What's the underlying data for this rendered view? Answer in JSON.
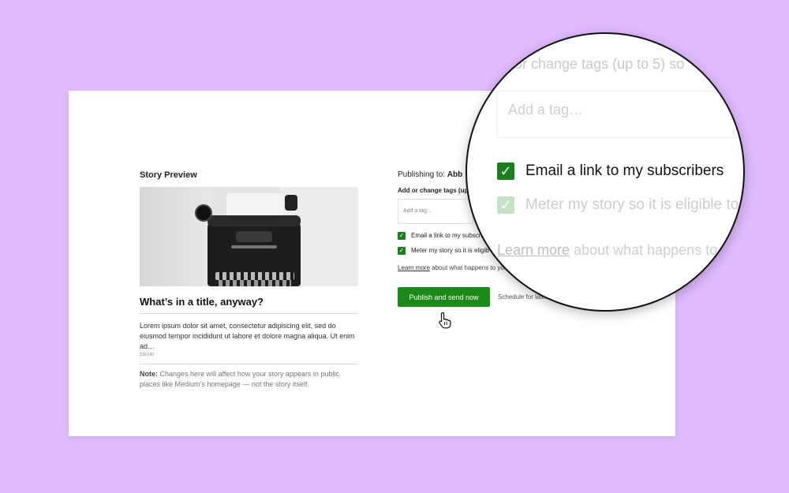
{
  "preview": {
    "heading": "Story Preview",
    "title": "What’s in a title, anyway?",
    "description": "Lorem ipsum dolor sit amet, consectetur adipiscing elit, sed do eiusmod tempor incididunt ut labore et dolore magna aliqua. Ut enim ad…",
    "char_count": "135/140",
    "note_label": "Note:",
    "note_text": " Changes here will affect how your story appears in public places like Medium’s homepage — not the story itself."
  },
  "publish": {
    "publishing_to_label": "Publishing to:",
    "publishing_to_value": "Abb",
    "tags_label": "Add or change tags (up",
    "tag_placeholder": "Add a tag…",
    "option_email": "Email a link to my subscri",
    "option_email_checked": true,
    "option_meter": "Meter my story so it is eligib",
    "option_meter_checked": true,
    "learn_more_link": "Learn more",
    "learn_more_rest": " about what happens to you",
    "publish_button": "Publish and send now",
    "schedule_link": "Schedule for later"
  },
  "magnifier": {
    "tags_label": "d or change tags (up to 5) so",
    "tag_placeholder": "Add a tag…",
    "option_email": "Email a link to my subscribers",
    "option_meter": "Meter my story so it is eligible to",
    "learn_more_link": "Learn more",
    "learn_more_rest": " about what happens to"
  },
  "colors": {
    "background": "#dfbbfe",
    "accent_green": "#1a8917",
    "checkbox_green": "#1a7f1a"
  }
}
